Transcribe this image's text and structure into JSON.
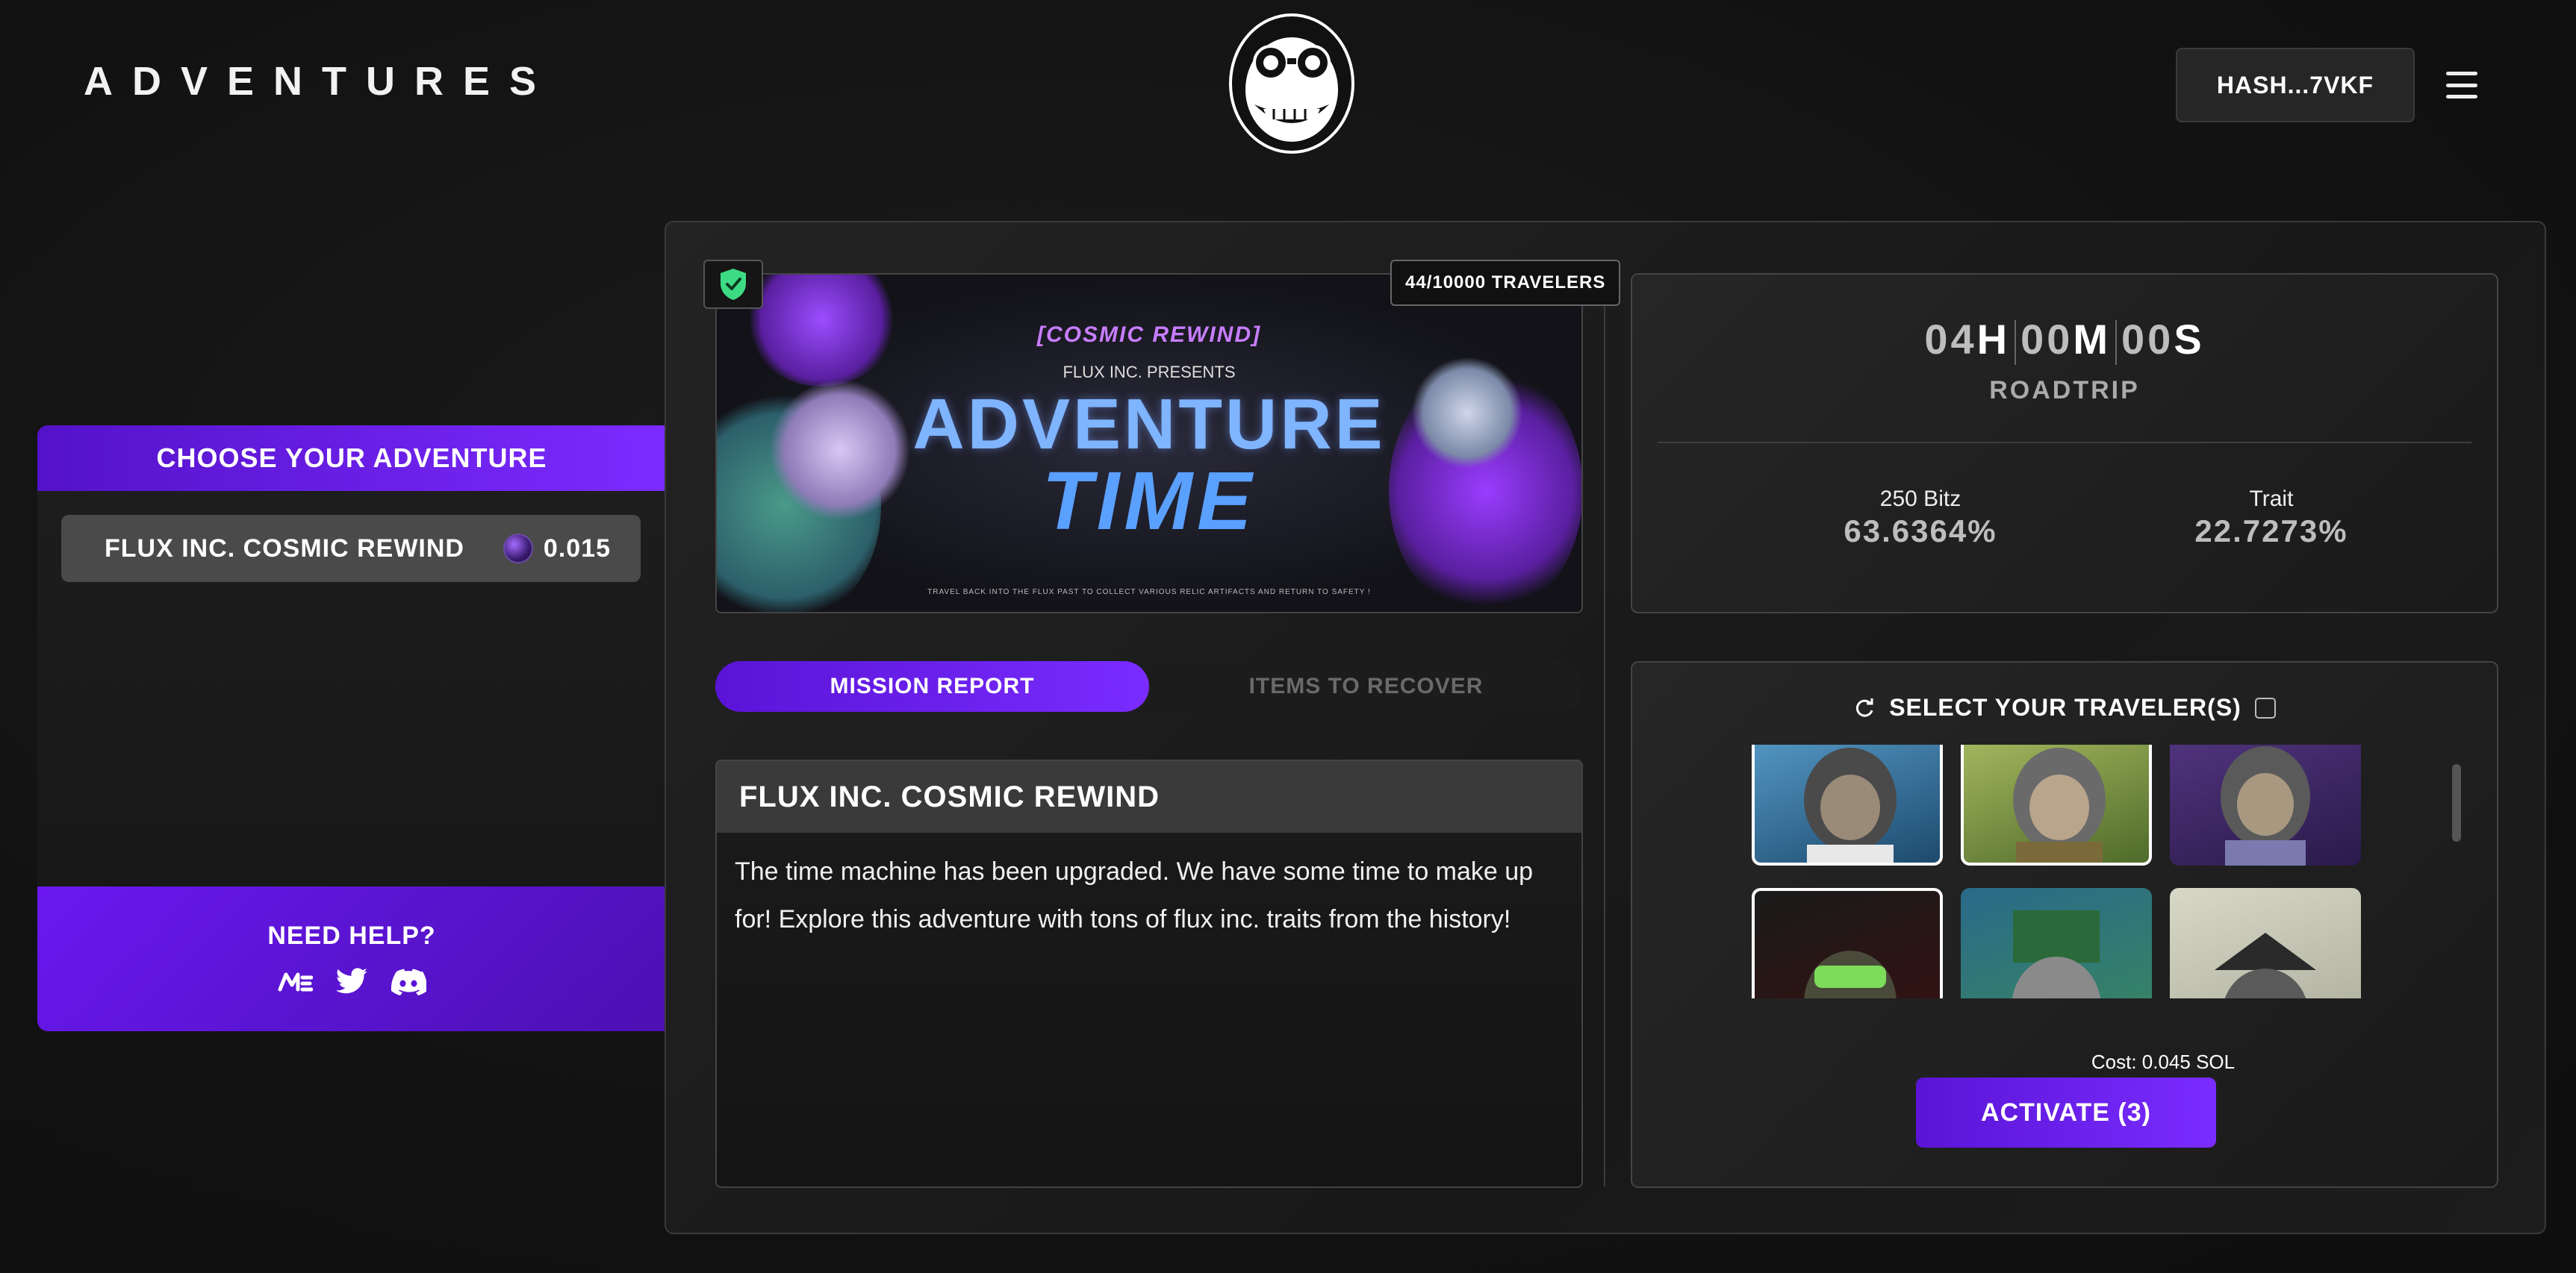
{
  "header": {
    "brand": "ADVENTURES",
    "wallet": "HASH...7VKF"
  },
  "sidebar": {
    "title": "CHOOSE YOUR ADVENTURE",
    "items": [
      {
        "label": "FLUX INC. COSMIC REWIND",
        "cost": "0.015"
      }
    ],
    "help": {
      "title": "NEED HELP?",
      "icons": [
        "magic-eden-icon",
        "twitter-icon",
        "discord-icon"
      ]
    }
  },
  "banner": {
    "travelers": "44/10000 TRAVELERS",
    "cosmic": "[COSMIC REWIND]",
    "presents": "FLUX INC. PRESENTS",
    "adventure": "ADVENTURE",
    "time": "TIME",
    "footer": "TRAVEL BACK INTO THE FLUX PAST TO COLLECT VARIOUS RELIC ARTIFACTS AND RETURN TO SAFETY !"
  },
  "tabs": [
    {
      "label": "MISSION REPORT",
      "active": true
    },
    {
      "label": "ITEMS TO RECOVER",
      "active": false
    }
  ],
  "report": {
    "title": "FLUX INC. COSMIC REWIND",
    "body": "The time machine has been upgraded. We have some time to make up for! Explore this adventure with tons of flux inc. traits from the history!"
  },
  "timer": {
    "hours": "04",
    "hours_unit": "H",
    "minutes": "00",
    "minutes_unit": "M",
    "seconds": "00",
    "seconds_unit": "S",
    "label": "ROADTRIP"
  },
  "stats": [
    {
      "label": "250 Bitz",
      "value": "63.6364%"
    },
    {
      "label": "Trait",
      "value": "22.7273%"
    }
  ],
  "select": {
    "title": "SELECT YOUR TRAVELER(S)",
    "cost": "Cost: 0.045 SOL",
    "activate": "ACTIVATE (3)"
  },
  "colors": {
    "accent": "#6a1ff0",
    "background": "#141414",
    "panel_border": "#3a3a3a"
  }
}
